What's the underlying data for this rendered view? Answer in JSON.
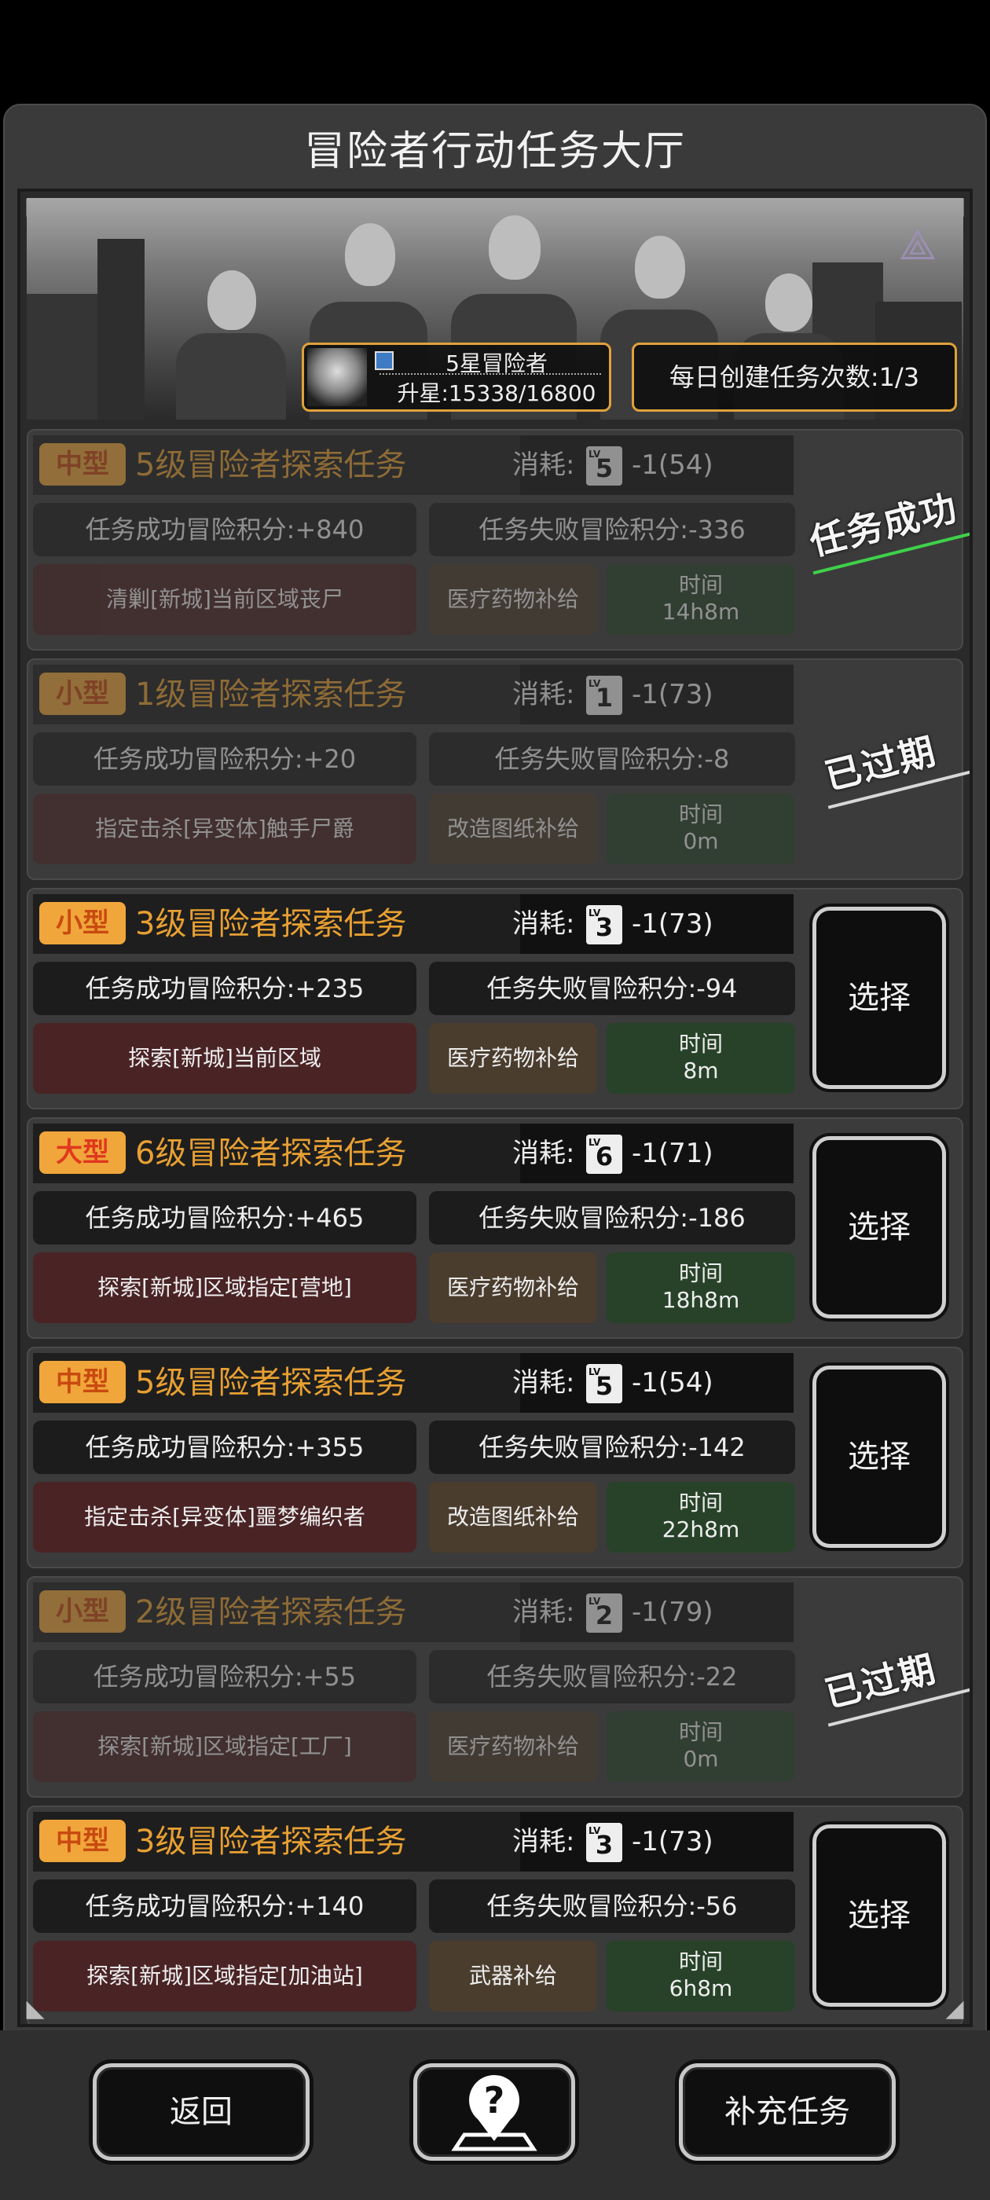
{
  "title": "冒险者行动任务大厅",
  "rank": {
    "name": "5星冒险者",
    "progress_text": "升星:15338/16800",
    "progress_value": 15338,
    "progress_max": 16800
  },
  "daily": {
    "text": "每日创建任务次数:1/3"
  },
  "cost_label": "消耗:",
  "success_prefix": "任务成功冒险积分:",
  "fail_prefix": "任务失败冒险积分:",
  "time_label": "时间",
  "select_label": "选择",
  "tasks": [
    {
      "size": "中型",
      "name": "5级冒险者探索任务",
      "lv": "5",
      "cost": "-1(54)",
      "success": "任务成功冒险积分:+840",
      "fail": "任务失败冒险积分:-336",
      "target": "清剿[新城]当前区域丧尸",
      "reward": "医疗药物补给",
      "time": "14h8m",
      "status": "任务成功"
    },
    {
      "size": "小型",
      "name": "1级冒险者探索任务",
      "lv": "1",
      "cost": "-1(73)",
      "success": "任务成功冒险积分:+20",
      "fail": "任务失败冒险积分:-8",
      "target": "指定击杀[异变体]触手尸爵",
      "reward": "改造图纸补给",
      "time": "0m",
      "status": "已过期"
    },
    {
      "size": "小型",
      "name": "3级冒险者探索任务",
      "lv": "3",
      "cost": "-1(73)",
      "success": "任务成功冒险积分:+235",
      "fail": "任务失败冒险积分:-94",
      "target": "探索[新城]当前区域",
      "reward": "医疗药物补给",
      "time": "8m",
      "status": "选择"
    },
    {
      "size": "大型",
      "name": "6级冒险者探索任务",
      "lv": "6",
      "cost": "-1(71)",
      "success": "任务成功冒险积分:+465",
      "fail": "任务失败冒险积分:-186",
      "target": "探索[新城]区域指定[营地]",
      "reward": "医疗药物补给",
      "time": "18h8m",
      "status": "选择"
    },
    {
      "size": "中型",
      "name": "5级冒险者探索任务",
      "lv": "5",
      "cost": "-1(54)",
      "success": "任务成功冒险积分:+355",
      "fail": "任务失败冒险积分:-142",
      "target": "指定击杀[异变体]噩梦编织者",
      "reward": "改造图纸补给",
      "time": "22h8m",
      "status": "选择"
    },
    {
      "size": "小型",
      "name": "2级冒险者探索任务",
      "lv": "2",
      "cost": "-1(79)",
      "success": "任务成功冒险积分:+55",
      "fail": "任务失败冒险积分:-22",
      "target": "探索[新城]区域指定[工厂]",
      "reward": "医疗药物补给",
      "time": "0m",
      "status": "已过期"
    },
    {
      "size": "中型",
      "name": "3级冒险者探索任务",
      "lv": "3",
      "cost": "-1(73)",
      "success": "任务成功冒险积分:+140",
      "fail": "任务失败冒险积分:-56",
      "target": "探索[新城]区域指定[加油站]",
      "reward": "武器补给",
      "time": "6h8m",
      "status": "选择"
    }
  ],
  "buttons": {
    "back": "返回",
    "help_icon": "help-map-icon",
    "refill": "补充任务"
  },
  "colors": {
    "size_small": "#d98b1e",
    "size_medium": "#d98b1e",
    "size_large": "#e0551e",
    "success_stamp_line": "#3fd14a",
    "expired_stamp_line": "#d8d8d8",
    "rank_border": "#e0a13b"
  }
}
